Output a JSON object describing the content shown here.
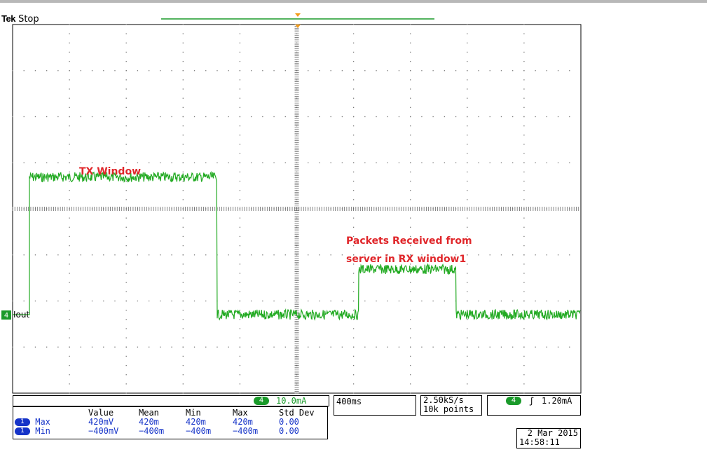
{
  "header": {
    "brand": "Tek",
    "status": "Stop"
  },
  "channel": {
    "marker": "4",
    "label": "Iout",
    "color": "#1a9a2a"
  },
  "annotations": {
    "tx_window": "TX Window",
    "rx_line1": "Packets Received from",
    "rx_line2": "server in RX window1",
    "color": "#e0262a"
  },
  "scale_box": {
    "channel": "4",
    "scale": "10.0mA"
  },
  "timebase": {
    "value": "400ms"
  },
  "sampling": {
    "rate": "2.50kS/s",
    "points": "10k points"
  },
  "trigger": {
    "channel": "4",
    "symbol": "ʃ",
    "level": "1.20mA"
  },
  "measurements": {
    "headers": [
      "Value",
      "Mean",
      "Min",
      "Max",
      "Std Dev"
    ],
    "rows": [
      {
        "badge": "1",
        "name": "Max",
        "values": [
          "420mV",
          "420m",
          "420m",
          "420m",
          "0.00"
        ]
      },
      {
        "badge": "1",
        "name": "Min",
        "values": [
          "−400mV",
          "−400m",
          "−400m",
          "−400m",
          "0.00"
        ]
      }
    ]
  },
  "datetime": {
    "date": "2 Mar 2015",
    "time": "14:58:11"
  },
  "trace_levels_div": {
    "baseline": 0,
    "tx_window": 3,
    "rx_window": 1
  }
}
